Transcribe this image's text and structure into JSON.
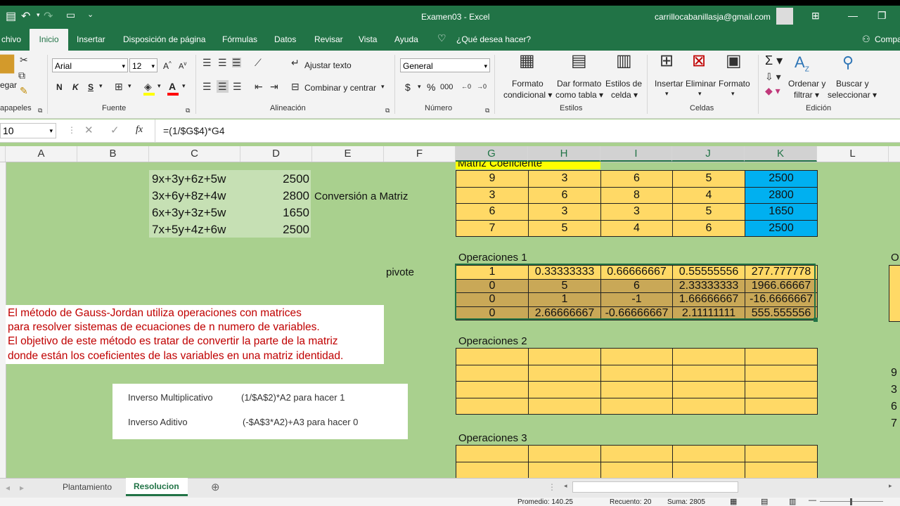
{
  "title": {
    "file": "Examen03",
    "sep": "-",
    "app": "Excel",
    "user": "carrillocabanillasja@gmail.com"
  },
  "ribbon_tabs": [
    "chivo",
    "Inicio",
    "Insertar",
    "Disposición de página",
    "Fórmulas",
    "Datos",
    "Revisar",
    "Vista",
    "Ayuda",
    "¿Qué desea hacer?",
    "Compa"
  ],
  "ribbon": {
    "font_name": "Arial",
    "font_size": "12",
    "bold": "N",
    "italic": "K",
    "underline": "S",
    "wrap_text": "Ajustar texto",
    "merge_center": "Combinar y centrar",
    "number_format": "General",
    "currency": "$",
    "percent": "%",
    "thousands": "000",
    "cond_format": [
      "Formato",
      "condicional"
    ],
    "table_format": [
      "Dar formato",
      "como tabla"
    ],
    "cell_styles": [
      "Estilos de",
      "celda"
    ],
    "insert": "Insertar",
    "delete": "Eliminar",
    "format": "Formato",
    "sort_filter": [
      "Ordenar y",
      "filtrar"
    ],
    "find_select": [
      "Buscar y",
      "seleccionar"
    ],
    "paste": "egar",
    "groups": [
      "apapeles",
      "Fuente",
      "Alineación",
      "Número",
      "Estilos",
      "Celdas",
      "Edición"
    ]
  },
  "formula_bar": {
    "name_box": "10",
    "fx": "fx",
    "formula": "=(1/$G$4)*G4"
  },
  "columns": [
    "A",
    "B",
    "C",
    "D",
    "E",
    "F",
    "G",
    "H",
    "I",
    "J",
    "K",
    "L"
  ],
  "equations": [
    {
      "expr": "9x+3y+6z+5w",
      "value": "2500"
    },
    {
      "expr": "3x+6y+8z+4w",
      "value": "2800"
    },
    {
      "expr": "6x+3y+3z+5w",
      "value": "1650"
    },
    {
      "expr": "7x+5y+4z+6w",
      "value": "2500"
    }
  ],
  "conversion_label": "Conversión a Matriz",
  "matrix_title": "Matriz Coeficiente",
  "matrix": [
    [
      "9",
      "3",
      "6",
      "5",
      "2500"
    ],
    [
      "3",
      "6",
      "8",
      "4",
      "2800"
    ],
    [
      "6",
      "3",
      "3",
      "5",
      "1650"
    ],
    [
      "7",
      "5",
      "4",
      "6",
      "2500"
    ]
  ],
  "ops1_title": "Operaciones 1",
  "pivot_label": "pivote",
  "ops1": [
    [
      "1",
      "0.33333333",
      "0.66666667",
      "0.55555556",
      "277.777778"
    ],
    [
      "0",
      "5",
      "6",
      "2.33333333",
      "1966.66667"
    ],
    [
      "0",
      "1",
      "-1",
      "1.66666667",
      "-16.6666667"
    ],
    [
      "0",
      "2.66666667",
      "-0.66666667",
      "2.11111111",
      "555.555556"
    ]
  ],
  "ops2_title": "Operaciones 2",
  "ops3_title": "Operaciones 3",
  "notes": [
    "El método de Gauss-Jordan utiliza operaciones con matrices",
    "para resolver sistemas de ecuaciones de n numero de variables.",
    "El objetivo de este método es tratar de convertir la parte de la matriz",
    "donde están los coeficientes de las variables en una matriz identidad."
  ],
  "inverse": {
    "mult_label": "Inverso Multiplicativo",
    "mult_formula": "(1/$A$2)*A2  para hacer 1",
    "add_label": "Inverso Aditivo",
    "add_formula": "(-$A$3*A2)+A3 para hacer 0"
  },
  "right_partial": {
    "op": "O",
    "eqs": [
      "9",
      "3",
      "6",
      "7"
    ]
  },
  "sheets": [
    "Plantamiento",
    "Resolucion"
  ],
  "active_sheet": "Resolucion",
  "status": {
    "avg": "Promedio: 140.25",
    "count": "Recuento: 20",
    "sum": "Suma: 2805"
  },
  "colors": {
    "excel_green": "#217346",
    "sheet_bg": "#a9d08e",
    "cell_yellow": "#ffd966",
    "cell_blue": "#00b0f0",
    "cell_gold": "#c9a857",
    "note_red": "#c00000"
  }
}
